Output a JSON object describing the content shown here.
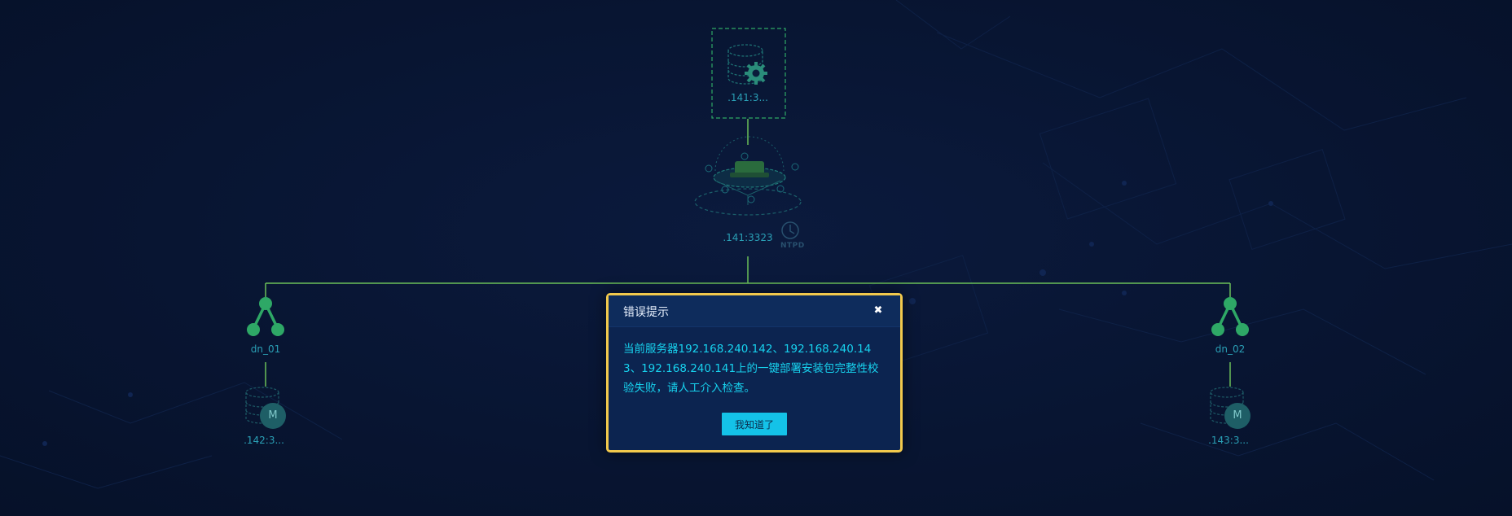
{
  "topology": {
    "mgmt_node": {
      "label": ".141:3...",
      "icon": "database-gear-icon"
    },
    "cluster_node": {
      "label": ".141:3323",
      "icon": "cluster-platform-icon",
      "ntp_badge": "NTPD"
    },
    "left_group": {
      "label": "dn_01",
      "db_label": ".142:3...",
      "db_badge": "M"
    },
    "right_group": {
      "label": "dn_02",
      "db_label": ".143:3...",
      "db_badge": "M"
    },
    "colors": {
      "line": "#6bbf59",
      "node_green": "#2ea866",
      "label": "#2a9fb5"
    }
  },
  "dialog": {
    "title": "错误提示",
    "close_icon": "✖",
    "message": "当前服务器192.168.240.142、192.168.240.143、192.168.240.141上的一键部署安装包完整性校验失败，请人工介入检查。",
    "confirm_label": "我知道了",
    "colors": {
      "border": "#f2c94c",
      "button": "#14c2e8",
      "text": "#17d2ee"
    }
  }
}
